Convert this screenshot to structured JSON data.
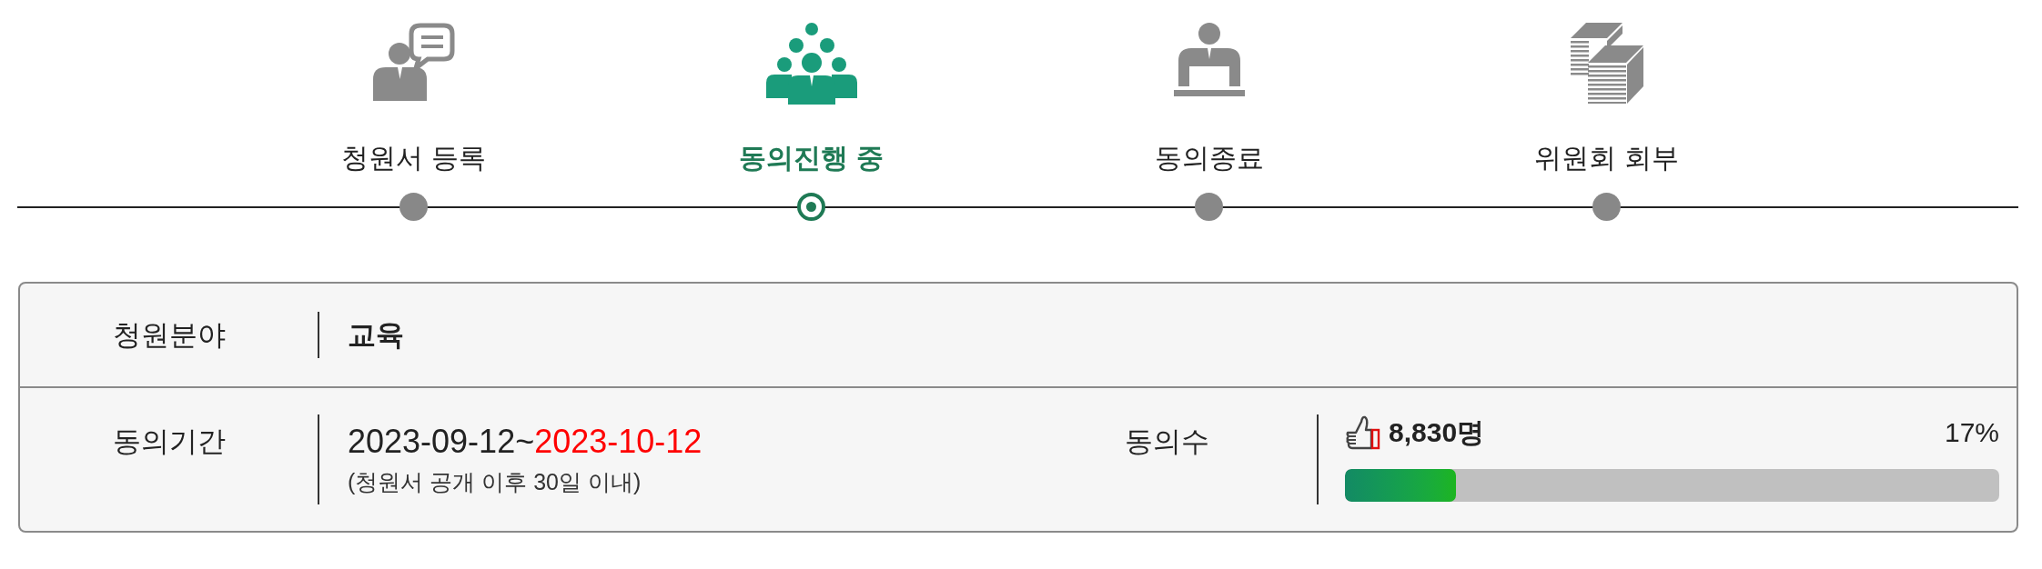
{
  "steps": [
    {
      "label": "청원서 등록",
      "selected": false
    },
    {
      "label": "동의진행 중",
      "selected": true
    },
    {
      "label": "동의종료",
      "selected": false
    },
    {
      "label": "위원회 회부",
      "selected": false
    }
  ],
  "details": {
    "field": {
      "label": "청원분야",
      "value": "교육"
    },
    "period": {
      "label": "동의기간",
      "start": "2023-09-12~",
      "end": "2023-10-12",
      "note": "(청원서 공개 이후 30일 이내)"
    },
    "agreements": {
      "label": "동의수",
      "count": "8,830명",
      "percent": "17%",
      "level": 0.17
    }
  }
}
